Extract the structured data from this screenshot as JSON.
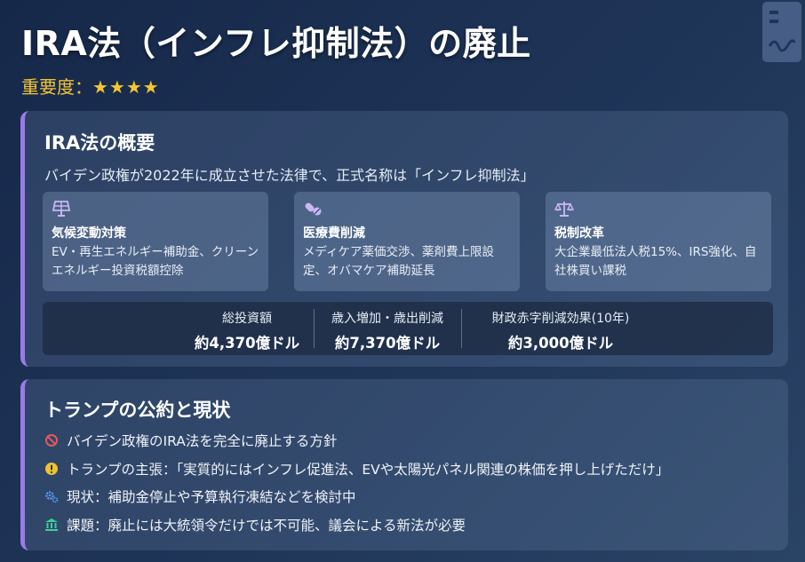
{
  "header": {
    "title": "IRA法（インフレ抑制法）の廃止",
    "importance_label": "重要度：",
    "importance_stars": "★★★★"
  },
  "overview": {
    "title": "IRA法の概要",
    "summary": "バイデン政権が2022年に成立させた法律で、正式名称は「インフレ抑制法」",
    "features": [
      {
        "icon": "solar-panel-icon",
        "name": "気候変動対策",
        "desc": "EV・再生エネルギー補助金、クリーンエネルギー投資税額控除"
      },
      {
        "icon": "pills-icon",
        "name": "医療費削減",
        "desc": "メディケア薬価交渉、薬剤費上限設定、オバマケア補助延長"
      },
      {
        "icon": "balance-scale-icon",
        "name": "税制改革",
        "desc": "大企業最低法人税15%、IRS強化、自社株買い課税"
      }
    ],
    "stats": [
      {
        "label": "総投資額",
        "value": "約4,370億ドル"
      },
      {
        "label": "歳入増加・歳出削減",
        "value": "約7,370億ドル"
      },
      {
        "label": "財政赤字削減効果(10年)",
        "value": "約3,000億ドル"
      }
    ]
  },
  "trump": {
    "title": "トランプの公約と現状",
    "items": [
      {
        "icon": "ban-icon",
        "color": "#e8585a",
        "text": "バイデン政権のIRA法を完全に廃止する方針"
      },
      {
        "icon": "exclamation-circle-icon",
        "color": "#f2c12e",
        "text": "トランプの主張：「実質的にはインフレ促進法、EVや太陽光パネル関連の株価を押し上げただけ」"
      },
      {
        "icon": "gears-icon",
        "color": "#5b9cf0",
        "text": "現状：補助金停止や予算執行凍結などを検討中"
      },
      {
        "icon": "landmark-icon",
        "color": "#3fcf9a",
        "text": "課題：廃止には大統領令だけでは不可能、議会による新法が必要"
      }
    ]
  },
  "colors": {
    "accent_border": "#9b7ae8",
    "star": "#f5c531",
    "feature_icon": "#c9b6f5"
  }
}
